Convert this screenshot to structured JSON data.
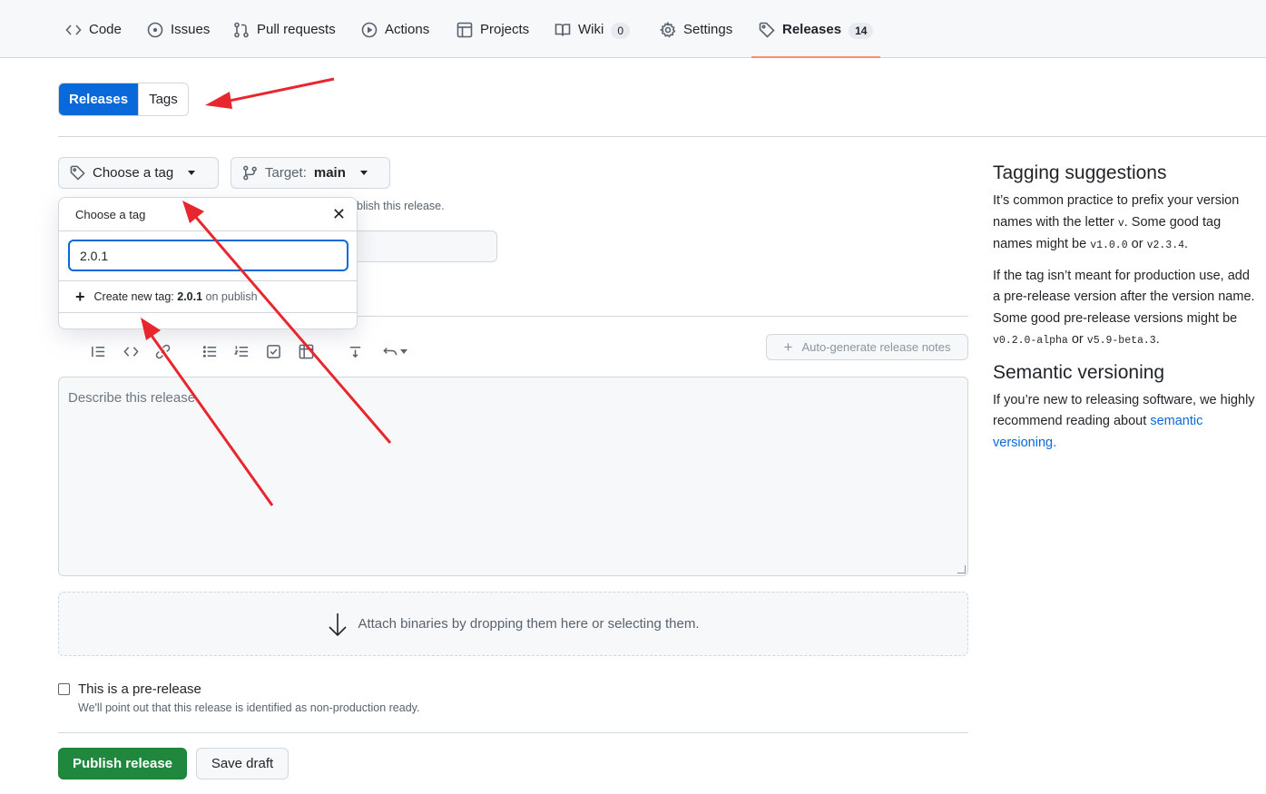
{
  "nav": {
    "tabs": [
      {
        "label": "Code",
        "icon": "code-icon"
      },
      {
        "label": "Issues",
        "icon": "issue-icon"
      },
      {
        "label": "Pull requests",
        "icon": "pull-request-icon"
      },
      {
        "label": "Actions",
        "icon": "play-icon"
      },
      {
        "label": "Projects",
        "icon": "table-icon"
      },
      {
        "label": "Wiki",
        "icon": "book-icon",
        "count": "0"
      },
      {
        "label": "Settings",
        "icon": "gear-icon"
      },
      {
        "label": "Releases",
        "icon": "tag-icon",
        "count": "14",
        "active": true
      }
    ]
  },
  "toggle": {
    "releases": "Releases",
    "tags": "Tags"
  },
  "tag_picker": {
    "button_label": "Choose a tag",
    "target_label": "Target:",
    "target_value": "main"
  },
  "behind_text": "blish this release.",
  "dropdown": {
    "title": "Choose a tag",
    "input_value": "2.0.1",
    "create_prefix": "Create new tag:",
    "create_tag": "2.0.1",
    "create_suffix": "on publish"
  },
  "editor": {
    "auto_generate": "Auto-generate release notes",
    "placeholder": "Describe this release"
  },
  "dropzone": "Attach binaries by dropping them here or selecting them.",
  "prerelease": {
    "label": "This is a pre-release",
    "note": "We'll point out that this release is identified as non-production ready."
  },
  "actions": {
    "publish": "Publish release",
    "save_draft": "Save draft"
  },
  "sidebar": {
    "tagging_title": "Tagging suggestions",
    "tagging_p1_a": "It’s common practice to prefix your version",
    "tagging_p1_b": "names with the letter",
    "tagging_p1_v": "v",
    "tagging_p1_c": ". Some good tag",
    "tagging_p1_d": "names might be",
    "tagging_p1_e1": "v1.0.0",
    "tagging_p1_or": "or",
    "tagging_p1_e2": "v2.3.4",
    "tagging_p1_end": ".",
    "tagging_p2_a": "If the tag isn’t meant for production use, add",
    "tagging_p2_b": "a pre-release version after the version name.",
    "tagging_p2_c": "Some good pre-release versions might be",
    "tagging_p2_e1": "v0.2.0-alpha",
    "tagging_p2_or": "or",
    "tagging_p2_e2": "v5.9-beta.3",
    "tagging_p2_end": ".",
    "semver_title": "Semantic versioning",
    "semver_a": "If you’re new to releasing software, we highly",
    "semver_b": "recommend reading about",
    "semver_link_1": "semantic",
    "semver_link_2": "versioning."
  },
  "colors": {
    "accent": "#0969da",
    "publish": "#1f883d",
    "annotation": "#e8262e",
    "active_tab_underline": "#fd8c73"
  }
}
